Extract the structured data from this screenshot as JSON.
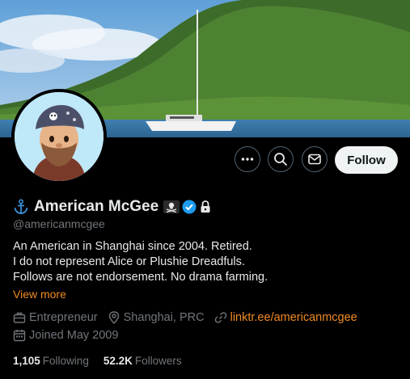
{
  "profile": {
    "name": "American McGee",
    "handle": "@americanmcgee",
    "bio": [
      "An American in Shanghai since 2004. Retired.",
      "I do not represent Alice or Plushie Dreadfuls.",
      "Follows are not endorsement. No drama farming."
    ],
    "view_more": "View more",
    "category": "Entrepreneur",
    "location": "Shanghai, PRC",
    "website": "linktr.ee/americanmcgee",
    "joined": "Joined May 2009",
    "following_count": "1,105",
    "following_label": "Following",
    "followers_count": "52.2K",
    "followers_label": "Followers"
  },
  "actions": {
    "follow_label": "Follow",
    "more_icon": "more-icon",
    "search_icon": "search-icon",
    "message_icon": "mail-icon"
  },
  "colors": {
    "accent": "#f08a24",
    "verified": "#1d9bf0",
    "muted": "#71767b",
    "text": "#e7e9ea"
  }
}
